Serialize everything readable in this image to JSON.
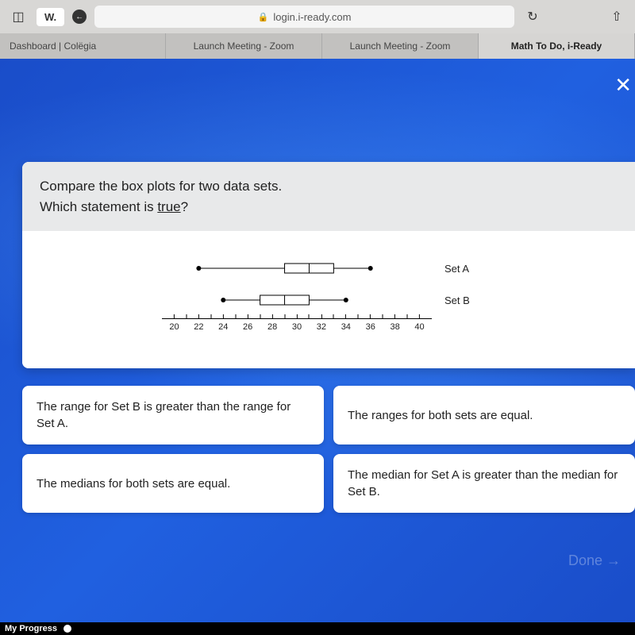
{
  "browser": {
    "sidebar_icon": "◫",
    "w_label": "W.",
    "url": "login.i-ready.com",
    "reload_icon": "↻",
    "share_icon": "⇧"
  },
  "tabs": [
    {
      "label": "Dashboard | Colëgia",
      "active": false
    },
    {
      "label": "Launch Meeting - Zoom",
      "active": false
    },
    {
      "label": "Launch Meeting - Zoom",
      "active": false
    },
    {
      "label": "Math To Do, i-Ready",
      "active": true
    }
  ],
  "question": {
    "line1": "Compare the box plots for two data sets.",
    "line2a": "Which statement is ",
    "line2b": "true",
    "line2c": "?"
  },
  "chart_data": {
    "type": "boxplot",
    "x_axis": {
      "min": 19,
      "max": 41,
      "ticks": [
        20,
        22,
        24,
        26,
        28,
        30,
        32,
        34,
        36,
        38,
        40
      ]
    },
    "series": [
      {
        "name": "Set A",
        "min": 22,
        "q1": 29,
        "median": 31,
        "q3": 33,
        "max": 36
      },
      {
        "name": "Set B",
        "min": 24,
        "q1": 27,
        "median": 29,
        "q3": 31,
        "max": 34
      }
    ]
  },
  "answers": [
    "The range for Set B is greater than the range for Set A.",
    "The ranges for both sets are equal.",
    "The medians for both sets are equal.",
    "The median for Set A is greater than the median for Set B."
  ],
  "done_label": "Done →",
  "footer": {
    "progress": "My Progress"
  }
}
